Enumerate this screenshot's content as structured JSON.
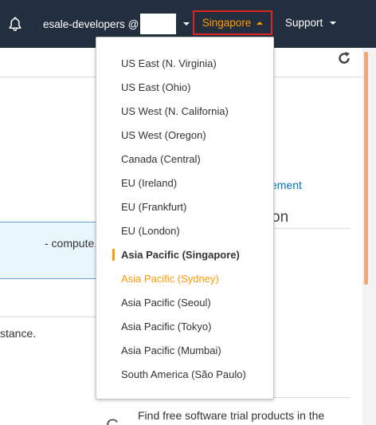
{
  "topbar": {
    "account_label": "esale-developers @",
    "region_label": "Singapore",
    "support_label": "Support"
  },
  "background": {
    "link_fragment": "ement",
    "heading_fragment": "on",
    "info_text": "- compute,",
    "instance_text": "stance.",
    "free_trial_text": "Find free software trial products in the"
  },
  "region_menu": {
    "items": [
      {
        "label": "US East (N. Virginia)"
      },
      {
        "label": "US East (Ohio)"
      },
      {
        "label": "US West (N. California)"
      },
      {
        "label": "US West (Oregon)"
      },
      {
        "label": "Canada (Central)"
      },
      {
        "label": "EU (Ireland)"
      },
      {
        "label": "EU (Frankfurt)"
      },
      {
        "label": "EU (London)"
      },
      {
        "label": "Asia Pacific (Singapore)",
        "selected": true
      },
      {
        "label": "Asia Pacific (Sydney)",
        "hovered": true
      },
      {
        "label": "Asia Pacific (Seoul)"
      },
      {
        "label": "Asia Pacific (Tokyo)"
      },
      {
        "label": "Asia Pacific (Mumbai)"
      },
      {
        "label": "South America (São Paulo)"
      }
    ]
  },
  "colors": {
    "nav_background": "#232f3e",
    "accent_orange": "#ff9900",
    "focus_border_red": "#e0241e",
    "link_blue": "#0073bb"
  },
  "icons": [
    "bell-icon",
    "chevron-down-icon",
    "chevron-up-icon",
    "refresh-icon"
  ]
}
